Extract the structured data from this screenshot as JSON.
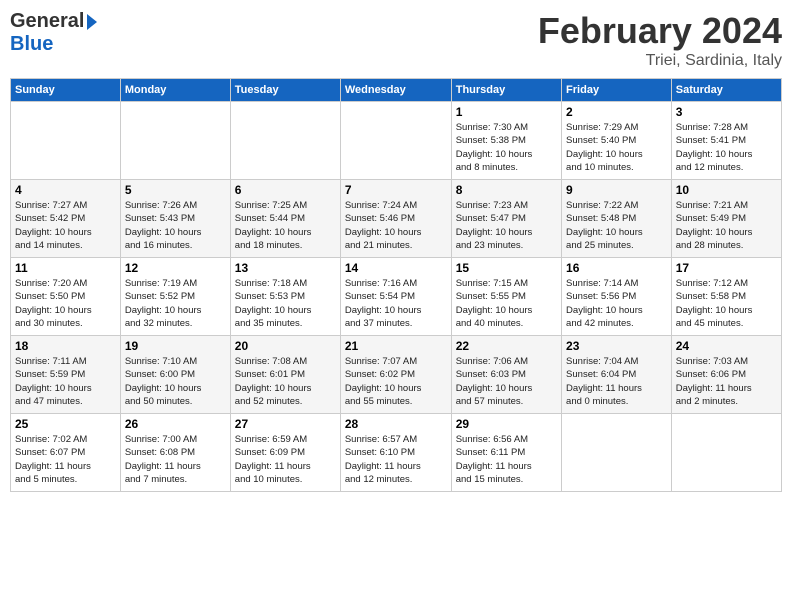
{
  "header": {
    "logo_general": "General",
    "logo_blue": "Blue",
    "month_title": "February 2024",
    "location": "Triei, Sardinia, Italy"
  },
  "calendar": {
    "days_of_week": [
      "Sunday",
      "Monday",
      "Tuesday",
      "Wednesday",
      "Thursday",
      "Friday",
      "Saturday"
    ],
    "weeks": [
      [
        {
          "day": "",
          "info": ""
        },
        {
          "day": "",
          "info": ""
        },
        {
          "day": "",
          "info": ""
        },
        {
          "day": "",
          "info": ""
        },
        {
          "day": "1",
          "info": "Sunrise: 7:30 AM\nSunset: 5:38 PM\nDaylight: 10 hours\nand 8 minutes."
        },
        {
          "day": "2",
          "info": "Sunrise: 7:29 AM\nSunset: 5:40 PM\nDaylight: 10 hours\nand 10 minutes."
        },
        {
          "day": "3",
          "info": "Sunrise: 7:28 AM\nSunset: 5:41 PM\nDaylight: 10 hours\nand 12 minutes."
        }
      ],
      [
        {
          "day": "4",
          "info": "Sunrise: 7:27 AM\nSunset: 5:42 PM\nDaylight: 10 hours\nand 14 minutes."
        },
        {
          "day": "5",
          "info": "Sunrise: 7:26 AM\nSunset: 5:43 PM\nDaylight: 10 hours\nand 16 minutes."
        },
        {
          "day": "6",
          "info": "Sunrise: 7:25 AM\nSunset: 5:44 PM\nDaylight: 10 hours\nand 18 minutes."
        },
        {
          "day": "7",
          "info": "Sunrise: 7:24 AM\nSunset: 5:46 PM\nDaylight: 10 hours\nand 21 minutes."
        },
        {
          "day": "8",
          "info": "Sunrise: 7:23 AM\nSunset: 5:47 PM\nDaylight: 10 hours\nand 23 minutes."
        },
        {
          "day": "9",
          "info": "Sunrise: 7:22 AM\nSunset: 5:48 PM\nDaylight: 10 hours\nand 25 minutes."
        },
        {
          "day": "10",
          "info": "Sunrise: 7:21 AM\nSunset: 5:49 PM\nDaylight: 10 hours\nand 28 minutes."
        }
      ],
      [
        {
          "day": "11",
          "info": "Sunrise: 7:20 AM\nSunset: 5:50 PM\nDaylight: 10 hours\nand 30 minutes."
        },
        {
          "day": "12",
          "info": "Sunrise: 7:19 AM\nSunset: 5:52 PM\nDaylight: 10 hours\nand 32 minutes."
        },
        {
          "day": "13",
          "info": "Sunrise: 7:18 AM\nSunset: 5:53 PM\nDaylight: 10 hours\nand 35 minutes."
        },
        {
          "day": "14",
          "info": "Sunrise: 7:16 AM\nSunset: 5:54 PM\nDaylight: 10 hours\nand 37 minutes."
        },
        {
          "day": "15",
          "info": "Sunrise: 7:15 AM\nSunset: 5:55 PM\nDaylight: 10 hours\nand 40 minutes."
        },
        {
          "day": "16",
          "info": "Sunrise: 7:14 AM\nSunset: 5:56 PM\nDaylight: 10 hours\nand 42 minutes."
        },
        {
          "day": "17",
          "info": "Sunrise: 7:12 AM\nSunset: 5:58 PM\nDaylight: 10 hours\nand 45 minutes."
        }
      ],
      [
        {
          "day": "18",
          "info": "Sunrise: 7:11 AM\nSunset: 5:59 PM\nDaylight: 10 hours\nand 47 minutes."
        },
        {
          "day": "19",
          "info": "Sunrise: 7:10 AM\nSunset: 6:00 PM\nDaylight: 10 hours\nand 50 minutes."
        },
        {
          "day": "20",
          "info": "Sunrise: 7:08 AM\nSunset: 6:01 PM\nDaylight: 10 hours\nand 52 minutes."
        },
        {
          "day": "21",
          "info": "Sunrise: 7:07 AM\nSunset: 6:02 PM\nDaylight: 10 hours\nand 55 minutes."
        },
        {
          "day": "22",
          "info": "Sunrise: 7:06 AM\nSunset: 6:03 PM\nDaylight: 10 hours\nand 57 minutes."
        },
        {
          "day": "23",
          "info": "Sunrise: 7:04 AM\nSunset: 6:04 PM\nDaylight: 11 hours\nand 0 minutes."
        },
        {
          "day": "24",
          "info": "Sunrise: 7:03 AM\nSunset: 6:06 PM\nDaylight: 11 hours\nand 2 minutes."
        }
      ],
      [
        {
          "day": "25",
          "info": "Sunrise: 7:02 AM\nSunset: 6:07 PM\nDaylight: 11 hours\nand 5 minutes."
        },
        {
          "day": "26",
          "info": "Sunrise: 7:00 AM\nSunset: 6:08 PM\nDaylight: 11 hours\nand 7 minutes."
        },
        {
          "day": "27",
          "info": "Sunrise: 6:59 AM\nSunset: 6:09 PM\nDaylight: 11 hours\nand 10 minutes."
        },
        {
          "day": "28",
          "info": "Sunrise: 6:57 AM\nSunset: 6:10 PM\nDaylight: 11 hours\nand 12 minutes."
        },
        {
          "day": "29",
          "info": "Sunrise: 6:56 AM\nSunset: 6:11 PM\nDaylight: 11 hours\nand 15 minutes."
        },
        {
          "day": "",
          "info": ""
        },
        {
          "day": "",
          "info": ""
        }
      ]
    ]
  }
}
